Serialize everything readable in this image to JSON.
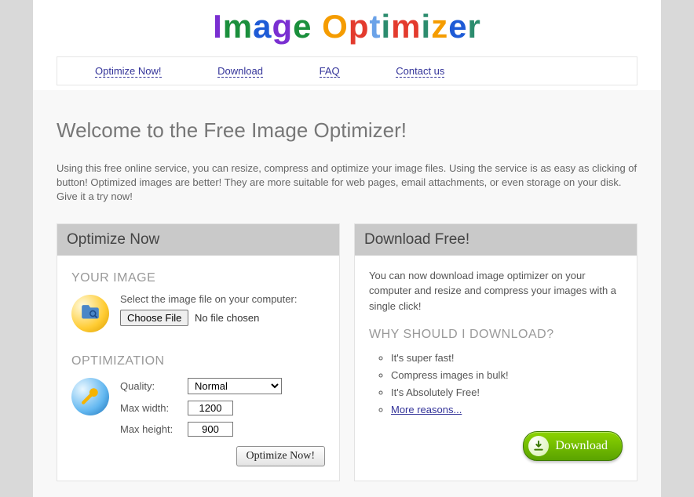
{
  "logo": "Image Optimizer",
  "nav": {
    "items": [
      {
        "label": "Optimize Now!"
      },
      {
        "label": "Download"
      },
      {
        "label": "FAQ"
      },
      {
        "label": "Contact us"
      }
    ]
  },
  "pageTitle": "Welcome to the Free Image Optimizer!",
  "intro": "Using this free online service, you can resize, compress and optimize your image files. Using the service is as easy as clicking of button! Optimized images are better! They are more suitable for web pages, email attachments, or even storage on your disk. Give it a try now!",
  "optimize": {
    "boxTitle": "Optimize Now",
    "yourImage": "YOUR IMAGE",
    "selectPrompt": "Select the image file on your computer:",
    "chooseFile": "Choose File",
    "noFile": "No file chosen",
    "optSection": "OPTIMIZATION",
    "qualityLabel": "Quality:",
    "qualityValue": "Normal",
    "maxWidthLabel": "Max width:",
    "maxWidthValue": "1200",
    "maxHeightLabel": "Max height:",
    "maxHeightValue": "900",
    "submit": "Optimize Now!"
  },
  "download": {
    "boxTitle": "Download Free!",
    "intro": "You can now download image optimizer on your computer and resize and compress your images with a single click!",
    "whyTitle": "WHY SHOULD I DOWNLOAD?",
    "reasons": [
      "It's super fast!",
      "Compress images in bulk!",
      "It's Absolutely Free!"
    ],
    "moreLink": "More reasons...",
    "button": "Download"
  }
}
